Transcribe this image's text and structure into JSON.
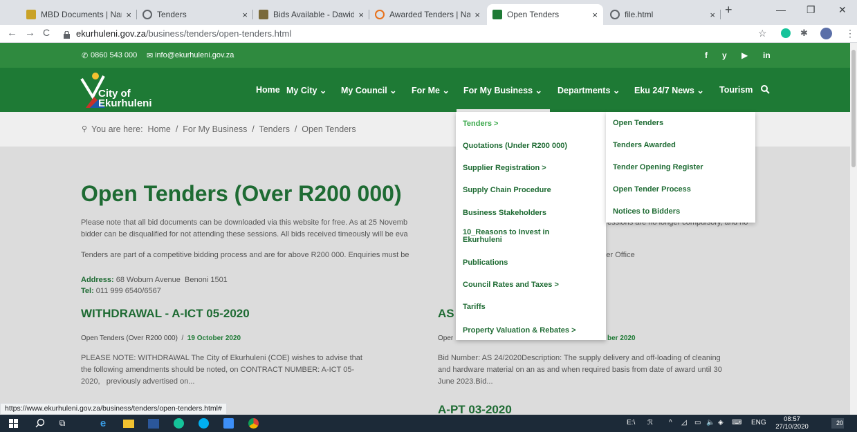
{
  "browser": {
    "tabs": [
      {
        "title": "MBD Documents | Nam",
        "close": "×"
      },
      {
        "title": "Tenders",
        "close": "×"
      },
      {
        "title": "Bids Available - Dawid",
        "close": "×"
      },
      {
        "title": "Awarded Tenders | Nat",
        "close": "×"
      },
      {
        "title": "Open Tenders",
        "close": "×"
      },
      {
        "title": "file.html",
        "close": "×"
      }
    ],
    "new_tab": "+",
    "minimize": "—",
    "maximize": "❐",
    "close": "✕",
    "back": "←",
    "forward": "→",
    "reload": "C",
    "url_host": "ekurhuleni.gov.za",
    "url_path": "/business/tenders/open-tenders.html",
    "status_url": "https://www.ekurhuleni.gov.za/business/tenders/open-tenders.html#"
  },
  "topbar": {
    "phone": "0860 543 000",
    "email": "info@ekurhuleni.gov.za",
    "social": [
      "f",
      "y",
      "▶",
      "in"
    ]
  },
  "logo": {
    "line1": "City of",
    "line2": "Ekurhuleni"
  },
  "nav": {
    "items": [
      "Home",
      "My City ⌄",
      "My Council ⌄",
      "For Me ⌄",
      "For My Business ⌄",
      "Departments ⌄",
      "Eku 24/7 News ⌄",
      "Tourism"
    ]
  },
  "breadcrumb": "You are here:  Home  /  For My Business  /  Tenders  /  Open Tenders",
  "page": {
    "title": "Open Tenders (Over R200 000)",
    "para1_a": "Please note that all bid documents can be downloaded via this website for free. As at 25 Novemb",
    "para1_b": "bidder can be disqualified for not attending these sessions. All bids received timeously will be eva",
    "para1_c": "essions are no longer compulsory, and no",
    "para2_a": "Tenders are part of a competitive bidding process and are for above R200 000. Enquiries must be",
    "para2_b": "ender Office",
    "address_label": "Address:",
    "address": " 68 Woburn Avenue  Benoni 1501",
    "tel_label": "Tel:",
    "tel": " 011 999 6540/6567"
  },
  "posts": {
    "left": {
      "title": "WITHDRAWAL - A-ICT 05-2020",
      "category": "Open Tenders (Over R200 000)  /  ",
      "date": "19 October 2020",
      "excerpt1": "PLEASE NOTE: WITHDRAWAL The City of Ekurhuleni (COE) wishes to advise that",
      "excerpt2": "the following amendments should be noted, on CONTRACT NUMBER: A-ICT 05-",
      "excerpt3": "2020,   previously advertised on..."
    },
    "right": {
      "title": "AS",
      "category": "Oper",
      "date": "ber 2020",
      "excerpt1": "Bid Number: AS 24/2020Description: The supply delivery and off-loading of cleaning",
      "excerpt2": "and hardware material on an as and when required basis from date of award until 30",
      "excerpt3": "June 2023.Bid...",
      "next_title": "A-PT 03-2020"
    }
  },
  "dropdown_business": [
    "Tenders >",
    "Quotations (Under R200 000)",
    "Supplier Registration >",
    "Supply Chain Procedure",
    "Business Stakeholders",
    "10_Reasons to Invest in",
    "Ekurhuleni",
    "Publications",
    "Council Rates and Taxes >",
    "Tariffs",
    "Property Valuation & Rebates >"
  ],
  "dropdown_tenders": [
    "Open Tenders",
    "Tenders Awarded",
    "Tender Opening Register",
    "Open Tender Process",
    "Notices to Bidders"
  ],
  "taskbar": {
    "tray_text1": "E:\\",
    "tray_lang": "ENG",
    "time": "08:57",
    "date": "27/10/2020",
    "notif": "20"
  },
  "colors": {
    "brand_green": "#1e7a35",
    "topbar_green": "#2f8a3f",
    "heading_green": "#1e6b33"
  }
}
